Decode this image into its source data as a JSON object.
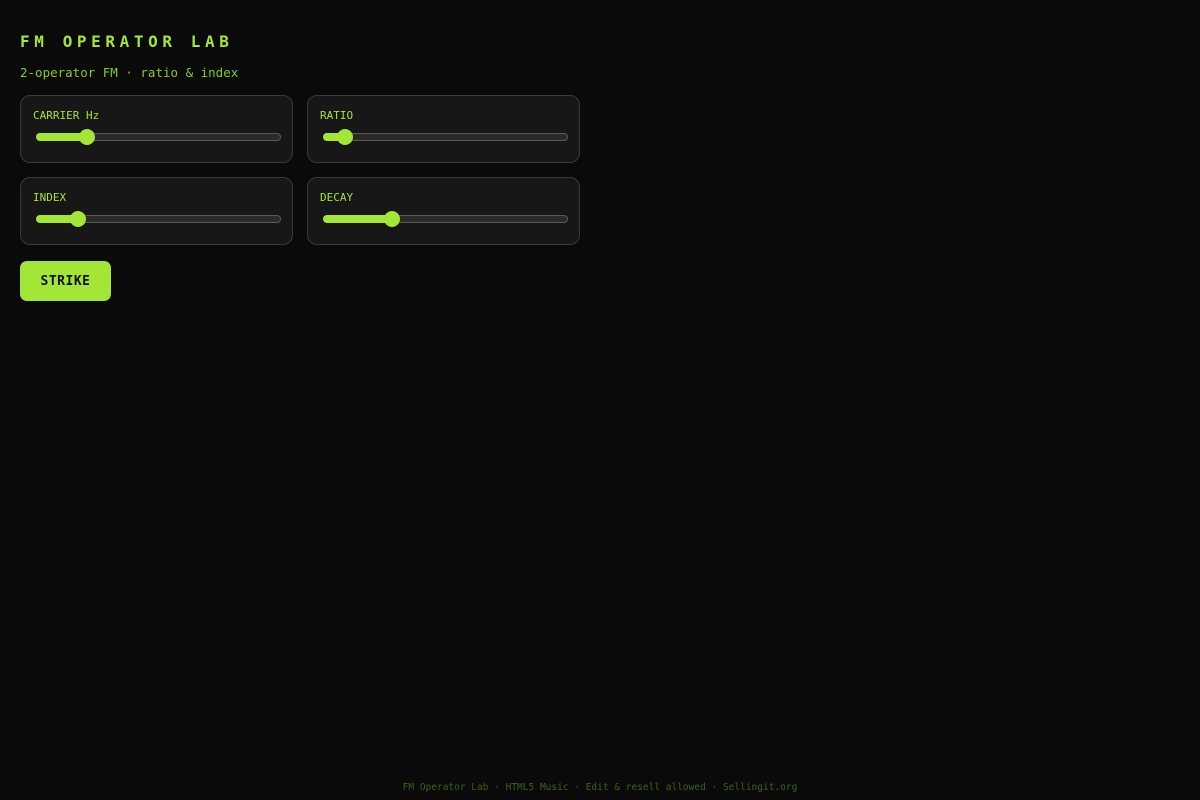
{
  "header": {
    "title": "FM OPERATOR LAB",
    "subtitle": "2-operator FM · ratio & index"
  },
  "controls": [
    {
      "label": "CARRIER Hz",
      "level_percent": 21
    },
    {
      "label": "RATIO",
      "level_percent": 9
    },
    {
      "label": "INDEX",
      "level_percent": 17
    },
    {
      "label": "DECAY",
      "level_percent": 28
    }
  ],
  "strike_button": {
    "label": "STRIKE"
  },
  "footer": {
    "text": "FM Operator Lab · HTML5 Music · Edit & resell allowed · Sellingit.org"
  },
  "colors": {
    "accent": "#a3e635",
    "background": "#0a0a0a",
    "card": "#171717",
    "footer": "#3f6212"
  }
}
